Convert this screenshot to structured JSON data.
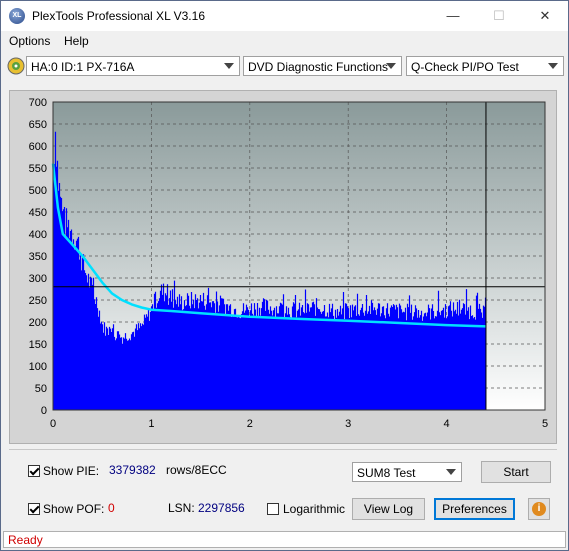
{
  "window": {
    "title": "PlexTools Professional XL V3.16",
    "icon_label": "XL",
    "minimize_glyph": "—",
    "maximize_glyph": "☐",
    "close_glyph": "✕"
  },
  "menu": {
    "options": "Options",
    "help": "Help"
  },
  "toolbar": {
    "drive": "HA:0 ID:1  PX-716A",
    "function": "DVD Diagnostic Functions",
    "test": "Q-Check PI/PO Test"
  },
  "chart_data": {
    "type": "area",
    "x_ticks": [
      "0",
      "1",
      "2",
      "3",
      "4",
      "5"
    ],
    "y_ticks": [
      "0",
      "50",
      "100",
      "150",
      "200",
      "250",
      "300",
      "350",
      "400",
      "450",
      "500",
      "550",
      "600",
      "650",
      "700"
    ],
    "xlim": [
      0,
      5
    ],
    "ylim": [
      0,
      700
    ],
    "grid": true,
    "colors": {
      "bars": "#0000ff",
      "avg_line": "#00e0ff",
      "bg_top": "#8a9a9a",
      "bg_bottom": "#ffffff"
    },
    "threshold_y": 280,
    "end_x": 4.4,
    "series": [
      {
        "kind": "pie_bars_envelope",
        "x": [
          0.0,
          0.02,
          0.05,
          0.08,
          0.1,
          0.15,
          0.2,
          0.25,
          0.3,
          0.35,
          0.4,
          0.45,
          0.5,
          0.55,
          0.6,
          0.7,
          0.8,
          0.9,
          1.0,
          1.05,
          1.1,
          1.15,
          1.2,
          1.3,
          1.5,
          1.7,
          1.9,
          2.1,
          2.3,
          2.5,
          2.7,
          2.9,
          3.1,
          3.3,
          3.5,
          3.7,
          3.9,
          4.1,
          4.3,
          4.4
        ],
        "values": [
          560,
          640,
          520,
          470,
          430,
          420,
          400,
          380,
          330,
          300,
          270,
          240,
          190,
          180,
          175,
          165,
          175,
          190,
          230,
          255,
          270,
          265,
          250,
          245,
          250,
          240,
          225,
          235,
          230,
          225,
          235,
          220,
          230,
          230,
          225,
          220,
          225,
          230,
          225,
          215
        ]
      },
      {
        "kind": "avg_line",
        "x": [
          0.0,
          0.05,
          0.1,
          0.2,
          0.3,
          0.4,
          0.5,
          0.6,
          0.7,
          0.8,
          0.9,
          1.0,
          1.2,
          1.5,
          2.0,
          2.5,
          3.0,
          3.5,
          4.0,
          4.4
        ],
        "values": [
          560,
          460,
          400,
          375,
          350,
          320,
          290,
          265,
          250,
          240,
          233,
          228,
          225,
          220,
          212,
          207,
          203,
          198,
          193,
          190
        ]
      }
    ]
  },
  "bottom": {
    "show_pie_label": "Show PIE:",
    "pie_value": "3379382",
    "pie_unit": "rows/8ECC",
    "show_pof_label": "Show POF:",
    "pof_value": "0",
    "lsn_label": "LSN:",
    "lsn_value": "2297856",
    "logarithmic_label": "Logarithmic",
    "sum_test": "SUM8 Test",
    "start": "Start",
    "view_log": "View Log",
    "preferences": "Preferences",
    "info_glyph": "i"
  },
  "status": {
    "text": "Ready"
  }
}
